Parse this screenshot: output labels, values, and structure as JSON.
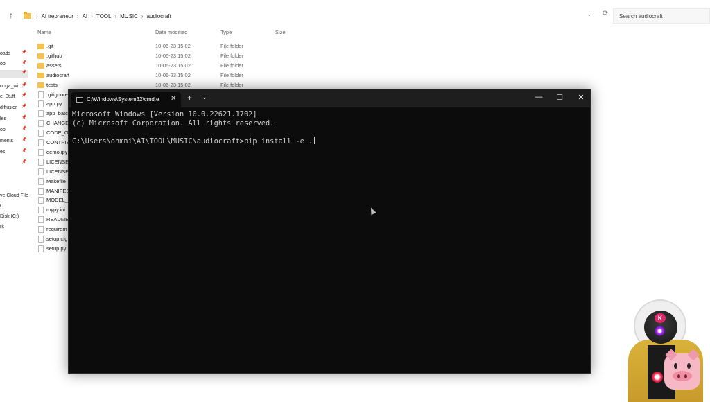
{
  "explorer": {
    "breadcrumb": [
      "Ai trepreneur",
      "AI",
      "TOOL",
      "MUSIC",
      "audiocraft"
    ],
    "search_placeholder": "Search audiocraft",
    "columns": {
      "name": "Name",
      "date": "Date modified",
      "type": "Type",
      "size": "Size"
    },
    "sidebar": [
      "oads",
      "op",
      "",
      "ooga_wi",
      "el Stuff",
      "diffusior",
      "les",
      "op",
      "ments",
      "es",
      "",
      "ve Cloud File",
      "C",
      "Disk (C:)",
      "rk"
    ],
    "files": [
      {
        "name": ".git",
        "date": "10-06-23 15:02",
        "type": "File folder",
        "kind": "folder"
      },
      {
        "name": ".github",
        "date": "10-06-23 15:02",
        "type": "File folder",
        "kind": "folder"
      },
      {
        "name": "assets",
        "date": "10-06-23 15:02",
        "type": "File folder",
        "kind": "folder"
      },
      {
        "name": "audiocraft",
        "date": "10-06-23 15:02",
        "type": "File folder",
        "kind": "folder"
      },
      {
        "name": "tests",
        "date": "10-06-23 15:02",
        "type": "File folder",
        "kind": "folder"
      },
      {
        "name": ".gitignore",
        "kind": "file"
      },
      {
        "name": "app.py",
        "kind": "file"
      },
      {
        "name": "app_batc",
        "kind": "file"
      },
      {
        "name": "CHANGEL",
        "kind": "file"
      },
      {
        "name": "CODE_OF",
        "kind": "file"
      },
      {
        "name": "CONTRIB",
        "kind": "file"
      },
      {
        "name": "demo.ipy",
        "kind": "file"
      },
      {
        "name": "LICENSE",
        "kind": "file"
      },
      {
        "name": "LICENSE_",
        "kind": "file"
      },
      {
        "name": "Makefile",
        "kind": "file"
      },
      {
        "name": "MANIFES",
        "kind": "file"
      },
      {
        "name": "MODEL_C",
        "kind": "file"
      },
      {
        "name": "mypy.ini",
        "kind": "file"
      },
      {
        "name": "READMEI",
        "kind": "file"
      },
      {
        "name": "requirem",
        "kind": "file"
      },
      {
        "name": "setup.cfg",
        "kind": "file"
      },
      {
        "name": "setup.py",
        "kind": "file"
      }
    ]
  },
  "terminal": {
    "tab_title": "C:\\Windows\\System32\\cmd.e",
    "line1": "Microsoft Windows [Version 10.0.22621.1702]",
    "line2": "(c) Microsoft Corporation. All rights reserved.",
    "prompt": "C:\\Users\\ohmni\\AI\\TOOL\\MUSIC\\audiocraft>",
    "command": "pip install -e ."
  },
  "avatar": {
    "badge": "K"
  }
}
